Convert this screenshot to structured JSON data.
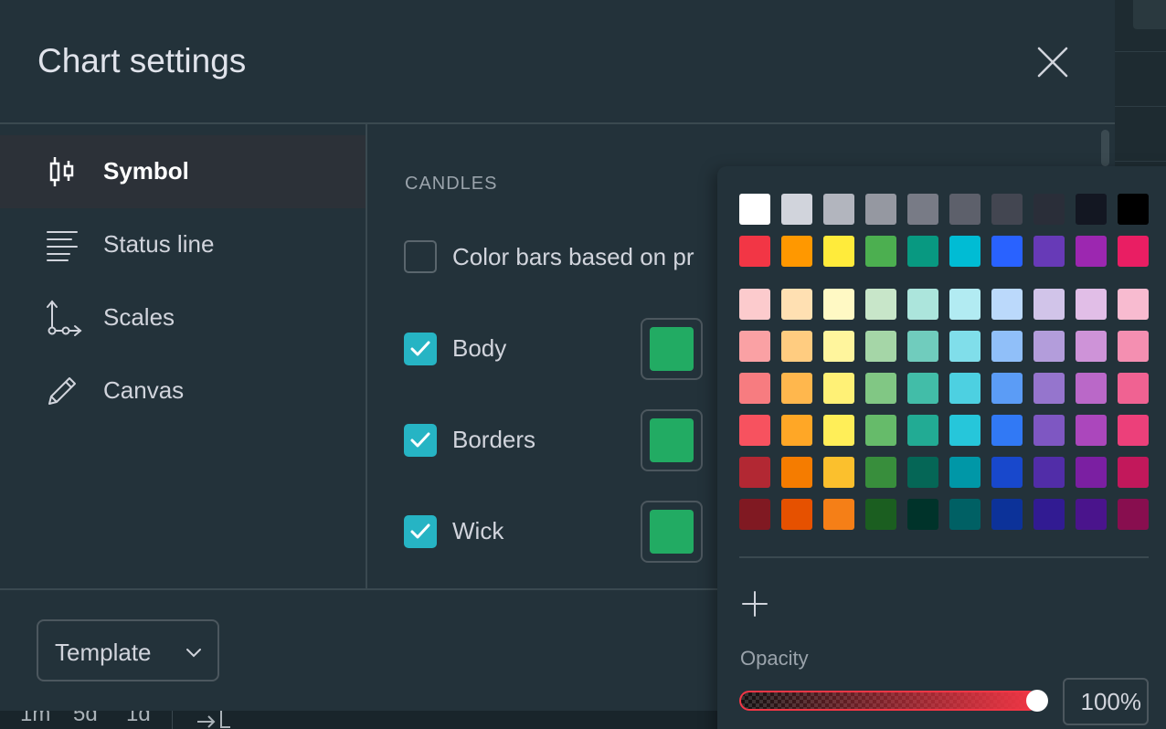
{
  "dialog": {
    "title": "Chart settings"
  },
  "sidebar": {
    "items": [
      {
        "label": "Symbol",
        "icon": "candles-icon",
        "active": true
      },
      {
        "label": "Status line",
        "icon": "status-lines-icon",
        "active": false
      },
      {
        "label": "Scales",
        "icon": "scales-axes-icon",
        "active": false
      },
      {
        "label": "Canvas",
        "icon": "pencil-icon",
        "active": false
      }
    ]
  },
  "content": {
    "section_title": "CANDLES",
    "color_bars_label": "Color bars based on pr",
    "color_bars_checked": false,
    "options": [
      {
        "label": "Body",
        "checked": true,
        "color": "#22ab63"
      },
      {
        "label": "Borders",
        "checked": true,
        "color": "#22ab63"
      },
      {
        "label": "Wick",
        "checked": true,
        "color": "#22ab63"
      }
    ]
  },
  "footer": {
    "template_label": "Template"
  },
  "timeframe_bar": [
    "1m",
    "5d",
    "1d"
  ],
  "color_picker": {
    "palette": [
      [
        "#ffffff",
        "#d1d4dc",
        "#b2b5be",
        "#9598a1",
        "#787b86",
        "#5d606b",
        "#434651",
        "#2a2e39",
        "#131722",
        "#000000"
      ],
      [
        "#f23645",
        "#ff9800",
        "#ffeb3b",
        "#4caf50",
        "#089981",
        "#00bcd4",
        "#2962ff",
        "#673ab7",
        "#9c27b0",
        "#e91e63"
      ]
    ],
    "shades": [
      [
        "#fccbcd",
        "#ffe0b2",
        "#fff9c4",
        "#c8e6c9",
        "#ace5dc",
        "#b2ebf2",
        "#bbd9fb",
        "#d1c4e9",
        "#e1bee7",
        "#f8bbd0"
      ],
      [
        "#faa1a4",
        "#ffcc80",
        "#fff59d",
        "#a5d6a7",
        "#70ccbd",
        "#80deea",
        "#90bff9",
        "#b39ddb",
        "#ce93d8",
        "#f48fb1"
      ],
      [
        "#f77c80",
        "#ffb74d",
        "#fff176",
        "#81c784",
        "#42bda8",
        "#4dd0e1",
        "#5b9cf6",
        "#9575cd",
        "#ba68c8",
        "#f06292"
      ],
      [
        "#f7525f",
        "#ffa726",
        "#ffee58",
        "#66bb6a",
        "#22ab94",
        "#26c6da",
        "#3179f5",
        "#7e57c2",
        "#ab47bc",
        "#ec407a"
      ],
      [
        "#b22833",
        "#f57c00",
        "#fbc02d",
        "#388e3c",
        "#056656",
        "#0097a7",
        "#1848cc",
        "#512da8",
        "#7b1fa2",
        "#c2185b"
      ],
      [
        "#801922",
        "#e65100",
        "#f57f17",
        "#1b5e20",
        "#00332a",
        "#006064",
        "#0c3299",
        "#311b92",
        "#4a148c",
        "#880e4f"
      ]
    ],
    "opacity_label": "Opacity",
    "opacity_value": "100%",
    "opacity_level": 1.0,
    "slider_color": "#f23645"
  }
}
